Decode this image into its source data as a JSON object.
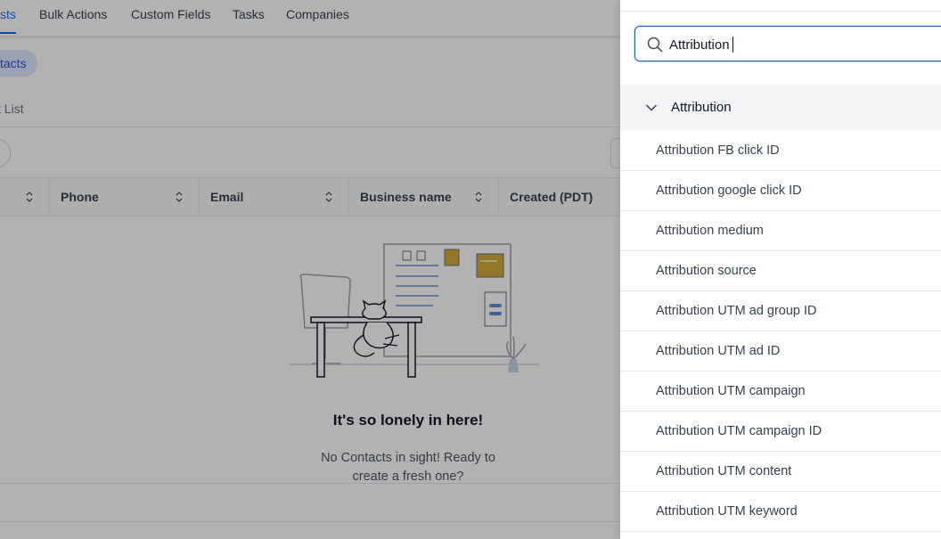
{
  "nav": {
    "tabs": [
      {
        "label": "sts",
        "active": true
      },
      {
        "label": "Bulk Actions",
        "active": false
      },
      {
        "label": "Custom Fields",
        "active": false
      },
      {
        "label": "Tasks",
        "active": false
      },
      {
        "label": "Companies",
        "active": false
      }
    ]
  },
  "filter_pill": {
    "label": "tacts"
  },
  "list_label": "t List",
  "table": {
    "columns": [
      "Phone",
      "Email",
      "Business name",
      "Created (PDT)"
    ]
  },
  "empty_state": {
    "title": "It's so lonely in here!",
    "line1": "No Contacts in sight! Ready to",
    "line2": "create a fresh one?"
  },
  "drawer": {
    "search": {
      "value": "Attribution"
    },
    "group": {
      "label": "Attribution",
      "expanded": true
    },
    "items": [
      "Attribution FB click ID",
      "Attribution google click ID",
      "Attribution medium",
      "Attribution source",
      "Attribution UTM ad group ID",
      "Attribution UTM ad ID",
      "Attribution UTM campaign",
      "Attribution UTM campaign ID",
      "Attribution UTM content",
      "Attribution UTM keyword"
    ]
  },
  "colors": {
    "accent": "#1570ef",
    "overlay": "rgba(0,0,0,0.30)",
    "pill_bg": "#dbe7ff",
    "group_bg": "#f3f4f6"
  },
  "icons": [
    "search-icon",
    "chevron-down-icon",
    "sort-icon",
    "empty-state-illustration"
  ]
}
